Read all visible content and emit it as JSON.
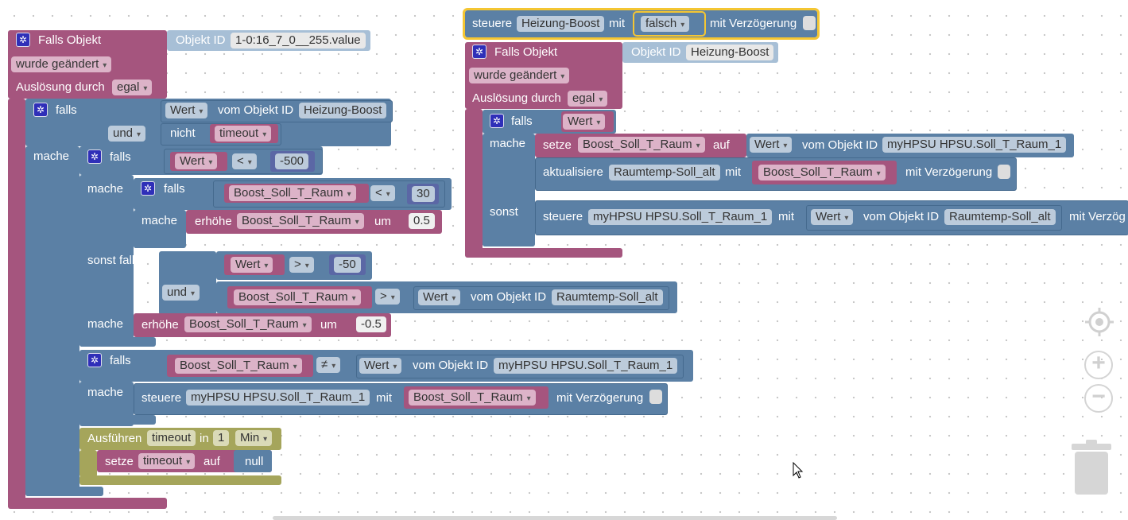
{
  "left": {
    "trigger": {
      "title": "Falls Objekt",
      "objlabel": "Objekt ID",
      "objid": "1-0:16_7_0__255.value",
      "changed": "wurde geändert",
      "by": "Auslösung durch",
      "by_val": "egal"
    },
    "if1": {
      "falls": "falls",
      "wert": "Wert",
      "vom": "vom Objekt ID",
      "obj": "Heizung-Boost",
      "und": "und",
      "nicht": "nicht",
      "timeout": "timeout",
      "mache": "mache"
    },
    "if2": {
      "falls": "falls",
      "wert": "Wert",
      "op": "<",
      "num": "-500",
      "mache": "mache"
    },
    "if3": {
      "falls": "falls",
      "var": "Boost_Soll_T_Raum",
      "op": "<",
      "num": "30",
      "mache": "mache",
      "erhoehe": "erhöhe",
      "um": "um",
      "amount": "0.5"
    },
    "elif": {
      "sonst": "sonst falls",
      "wert": "Wert",
      "op": ">",
      "num": "-50",
      "und": "und",
      "var": "Boost_Soll_T_Raum",
      "op2": ">",
      "wert2": "Wert",
      "vom": "vom Objekt ID",
      "obj": "Raumtemp-Soll_alt",
      "mache": "mache",
      "erhoehe": "erhöhe",
      "um": "um",
      "amount": "-0.5"
    },
    "if4": {
      "falls": "falls",
      "var": "Boost_Soll_T_Raum",
      "op": "≠",
      "wert": "Wert",
      "vom": "vom Objekt ID",
      "obj": "myHPSU HPSU.Soll_T_Raum_1",
      "mache": "mache",
      "steuere": "steuere",
      "target": "myHPSU HPSU.Soll_T_Raum_1",
      "mit": "mit",
      "var2": "Boost_Soll_T_Raum",
      "delay": "mit Verzögerung"
    },
    "timer": {
      "ausfuehren": "Ausführen",
      "name": "timeout",
      "in": "in",
      "num": "1",
      "unit": "Min",
      "setze": "setze",
      "var": "timeout",
      "auf": "auf",
      "null": "null"
    }
  },
  "right": {
    "ctrl": {
      "steuere": "steuere",
      "target": "Heizung-Boost",
      "mit": "mit",
      "val": "falsch",
      "delay": "mit Verzögerung"
    },
    "trigger": {
      "title": "Falls Objekt",
      "objlabel": "Objekt ID",
      "objid": "Heizung-Boost",
      "changed": "wurde geändert",
      "by": "Auslösung durch",
      "by_val": "egal"
    },
    "if": {
      "falls": "falls",
      "wert": "Wert",
      "mache": "mache",
      "setze": "setze",
      "var": "Boost_Soll_T_Raum",
      "auf": "auf",
      "wert2": "Wert",
      "vom": "vom Objekt ID",
      "obj": "myHPSU HPSU.Soll_T_Raum_1",
      "akt": "aktualisiere",
      "aktvar": "Raumtemp-Soll_alt",
      "mit": "mit",
      "var2": "Boost_Soll_T_Raum",
      "delay": "mit Verzögerung",
      "sonst": "sonst",
      "steuere": "steuere",
      "target": "myHPSU HPSU.Soll_T_Raum_1",
      "mit2": "mit",
      "wert3": "Wert",
      "vom2": "vom Objekt ID",
      "obj2": "Raumtemp-Soll_alt",
      "delay2": "mit Verzög"
    }
  },
  "controls": {
    "center": "target-icon",
    "zoom_in": "+",
    "zoom_out": "−",
    "trash": "trash-icon"
  }
}
